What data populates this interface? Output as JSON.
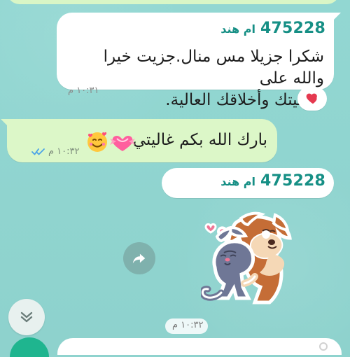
{
  "chat": {
    "top_message_partial": "",
    "message_1": {
      "sender_number": "475228",
      "sender_name": "ام هند",
      "text": "شكرا جزيلا مس منال.جزيت خيرا والله على\nحرفيتك وأخلاقك العالية.",
      "time": "١٠:٣١ م",
      "reaction_icon": "heart-icon"
    },
    "message_2": {
      "text": "بارك الله بكم غاليتي",
      "time": "١٠:٣٢ م",
      "status_icon": "double-check-icon",
      "emoji_icons": [
        "smiling-face-with-hearts-icon",
        "heart-ribbon-icon"
      ]
    },
    "message_3": {
      "sender_number": "475228",
      "sender_name": "ام هند"
    },
    "sticker": {
      "icon": "dog-cat-hug-sticker",
      "time": "١٠:٣٢ م"
    },
    "controls": {
      "forward_icon": "forward-icon",
      "scroll_down_icon": "chevron-down-icon"
    }
  },
  "colors": {
    "background": "#8fd3ce",
    "incoming_bubble": "#ffffff",
    "outgoing_bubble": "#dcf7c8",
    "sender_text": "#168f85",
    "time_text": "#7b7b7b",
    "accent": "#1fb58f",
    "heart": "#e53950",
    "tick": "#4aa3e8"
  }
}
